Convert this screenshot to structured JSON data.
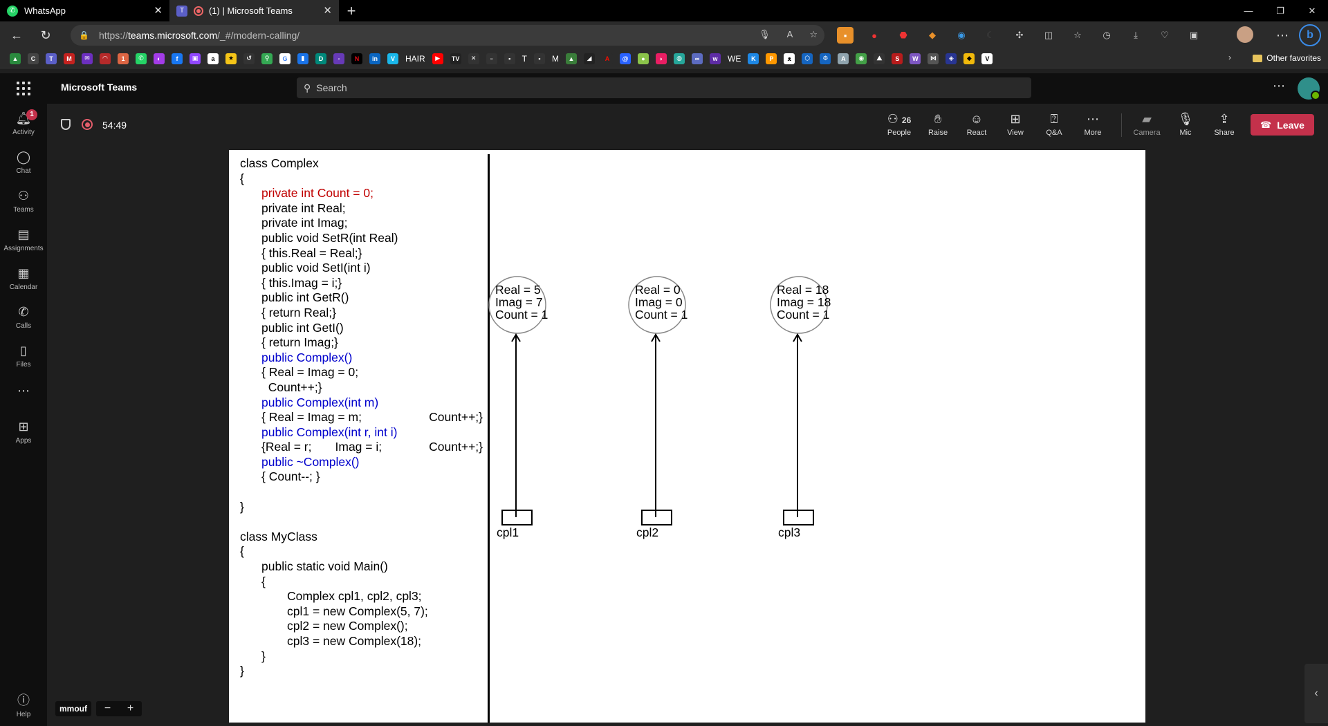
{
  "browser": {
    "tabs": [
      {
        "title": "WhatsApp",
        "active": false
      },
      {
        "title": "(1) | Microsoft Teams",
        "active": true
      }
    ],
    "url_scheme": "https://",
    "url_host": "teams.microsoft.com",
    "url_path": "/_#/modern-calling/",
    "favorites": {
      "labels": [
        "HAIR",
        "T",
        "M",
        "WE"
      ],
      "other_favorites": "Other favorites"
    }
  },
  "teams": {
    "app_title": "Microsoft Teams",
    "search_placeholder": "Search",
    "rail": [
      {
        "label": "Activity",
        "icon": "bell-icon",
        "badge": "1"
      },
      {
        "label": "Chat",
        "icon": "chat-icon"
      },
      {
        "label": "Teams",
        "icon": "teams-icon"
      },
      {
        "label": "Assignments",
        "icon": "assignments-icon"
      },
      {
        "label": "Calendar",
        "icon": "calendar-icon"
      },
      {
        "label": "Calls",
        "icon": "phone-icon"
      },
      {
        "label": "Files",
        "icon": "file-icon"
      },
      {
        "label": "Apps",
        "icon": "apps-icon"
      },
      {
        "label": "Help",
        "icon": "help-icon"
      }
    ],
    "meeting": {
      "timer": "54:49",
      "people_count": "26",
      "controls": [
        "People",
        "Raise",
        "React",
        "View",
        "Q&A",
        "More",
        "Camera",
        "Mic",
        "Share"
      ],
      "leave_label": "Leave"
    },
    "speaker_name": "mmouf",
    "accent_color": "#c4314b"
  },
  "slide": {
    "code_lines": [
      {
        "indent": 0,
        "text": "class Complex",
        "color": "black"
      },
      {
        "indent": 0,
        "text": "{",
        "color": "black"
      },
      {
        "indent": 1,
        "text": "private int Count = 0;",
        "color": "red"
      },
      {
        "indent": 1,
        "text": "private int Real;",
        "color": "black"
      },
      {
        "indent": 1,
        "text": "private int Imag;",
        "color": "black"
      },
      {
        "indent": 1,
        "text": "public void SetR(int Real)",
        "color": "black"
      },
      {
        "indent": 1,
        "text": "{ this.Real = Real;}",
        "color": "black"
      },
      {
        "indent": 1,
        "text": "public void SetI(int i)",
        "color": "black"
      },
      {
        "indent": 1,
        "text": "{ this.Imag = i;}",
        "color": "black"
      },
      {
        "indent": 1,
        "text": "public int GetR()",
        "color": "black"
      },
      {
        "indent": 1,
        "text": "{ return Real;}",
        "color": "black"
      },
      {
        "indent": 1,
        "text": "public int GetI()",
        "color": "black"
      },
      {
        "indent": 1,
        "text": "{ return Imag;}",
        "color": "black"
      },
      {
        "indent": 1,
        "text": "public Complex()",
        "color": "blue"
      },
      {
        "indent": 1,
        "text": "{ Real = Imag = 0;",
        "color": "black"
      },
      {
        "indent": 1,
        "text": "  Count++;}",
        "color": "black"
      },
      {
        "indent": 1,
        "text": "public Complex(int m)",
        "color": "blue"
      },
      {
        "indent": 1,
        "text": "{ Real = Imag = m;                    Count++;}",
        "color": "black"
      },
      {
        "indent": 1,
        "text": "public Complex(int r, int i)",
        "color": "blue"
      },
      {
        "indent": 1,
        "text": "{Real = r;       Imag = i;              Count++;}",
        "color": "black"
      },
      {
        "indent": 1,
        "text": "public ~Complex()",
        "color": "blue"
      },
      {
        "indent": 1,
        "text": "{ Count--; }",
        "color": "black"
      },
      {
        "indent": 0,
        "text": "",
        "color": "black"
      },
      {
        "indent": 0,
        "text": "}",
        "color": "black"
      },
      {
        "indent": 0,
        "text": "",
        "color": "black"
      },
      {
        "indent": 0,
        "text": "class MyClass",
        "color": "black"
      },
      {
        "indent": 0,
        "text": "{",
        "color": "black"
      },
      {
        "indent": 1,
        "text": "public static void Main()",
        "color": "black"
      },
      {
        "indent": 1,
        "text": "{",
        "color": "black"
      },
      {
        "indent": 2,
        "text": "Complex cpl1, cpl2, cpl3;",
        "color": "black"
      },
      {
        "indent": 2,
        "text": "cpl1 = new Complex(5, 7);",
        "color": "black"
      },
      {
        "indent": 2,
        "text": "cpl2 = new Complex();",
        "color": "black"
      },
      {
        "indent": 2,
        "text": "cpl3 = new Complex(18);",
        "color": "black"
      },
      {
        "indent": 1,
        "text": "}",
        "color": "black"
      },
      {
        "indent": 0,
        "text": "}",
        "color": "black"
      }
    ],
    "objects": [
      {
        "var": "cpl1",
        "lines": [
          "Real = 5",
          "Imag = 7",
          "Count = 1"
        ]
      },
      {
        "var": "cpl2",
        "lines": [
          "Real = 0",
          "Imag = 0",
          "Count = 1"
        ]
      },
      {
        "var": "cpl3",
        "lines": [
          "Real = 18",
          "Imag = 18",
          "Count = 1"
        ]
      }
    ],
    "colors": {
      "red": "#c00000",
      "blue": "#0000cc"
    }
  }
}
